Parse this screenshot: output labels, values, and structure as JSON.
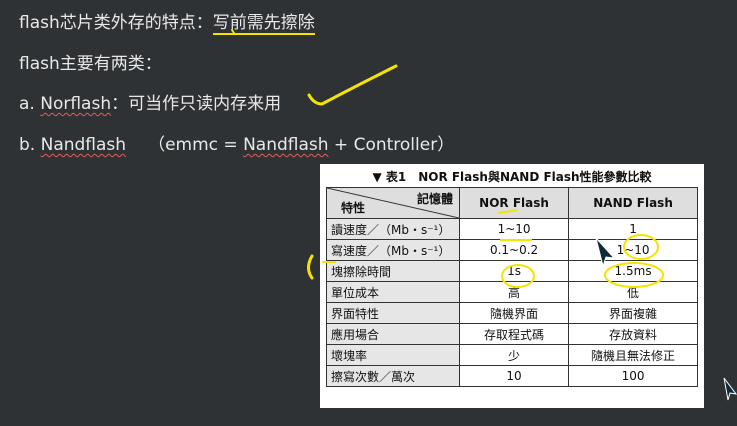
{
  "notes": {
    "line1": {
      "prefix": "flash芯片类外存的特点：",
      "highlight": "写前需先擦除"
    },
    "line2": "flash主要有两类：",
    "line3": {
      "marker": "a. ",
      "term": "Norflash",
      "rest": "：可当作只读内存来用"
    },
    "line4": {
      "marker": "b. ",
      "term1": "Nandflash",
      "paren_open": "（emmc = ",
      "term2": "Nandflash",
      "paren_rest": " + Controller）"
    }
  },
  "table": {
    "title": "▼ 表1　NOR Flash與NAND Flash性能參數比較",
    "corner_top": "記憶體",
    "corner_bottom": "特性",
    "col1": "NOR Flash",
    "col2": "NAND Flash",
    "rows": [
      {
        "label": "讀速度／（Mb・s⁻¹）",
        "nor": "1~10",
        "nand": "1"
      },
      {
        "label": "寫速度／（Mb・s⁻¹）",
        "nor": "0.1~0.2",
        "nand": "1~10"
      },
      {
        "label": "塊擦除時間",
        "nor": "1s",
        "nand": "1.5ms"
      },
      {
        "label": "單位成本",
        "nor": "高",
        "nand": "低"
      },
      {
        "label": "界面特性",
        "nor": "隨機界面",
        "nand": "界面複雜"
      },
      {
        "label": "應用場合",
        "nor": "存取程式碼",
        "nand": "存放資料"
      },
      {
        "label": "壞塊率",
        "nor": "少",
        "nand": "隨機且無法修正"
      },
      {
        "label": "擦寫次數／萬次",
        "nor": "10",
        "nand": "100"
      }
    ]
  },
  "colors": {
    "background": "#2f3234",
    "annotation": "#f5e300",
    "spellcheck": "#e25b5b"
  }
}
